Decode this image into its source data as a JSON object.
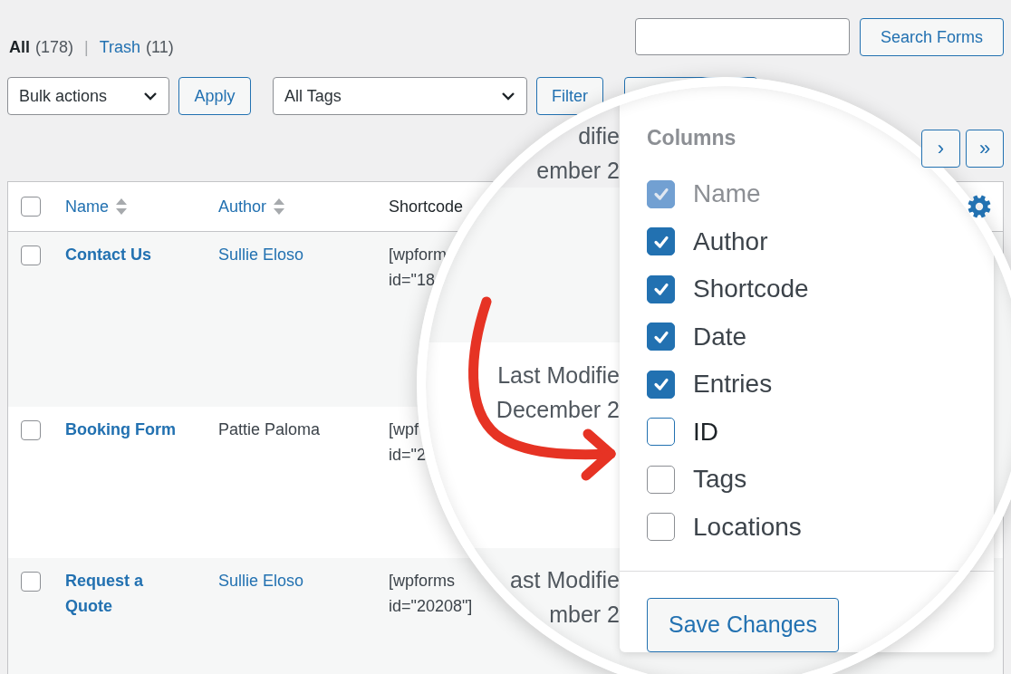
{
  "views": [
    {
      "label": "All",
      "count": "(178)",
      "selected": true
    },
    {
      "label": "Trash",
      "count": "(11)",
      "selected": false
    }
  ],
  "view_separator": "|",
  "search": {
    "button": "Search Forms"
  },
  "bulk_actions": {
    "value": "Bulk actions",
    "button": "Apply"
  },
  "tag_filter": {
    "value": "All Tags",
    "button": "Filter"
  },
  "pagination": [
    "›",
    "»"
  ],
  "table": {
    "header_checkbox": {
      "checked": false
    },
    "columns": [
      {
        "label": "Name",
        "sortable": true
      },
      {
        "label": "Author",
        "sortable": true
      },
      {
        "label": "Shortcode",
        "sortable": false
      }
    ],
    "rows": [
      {
        "checked": false,
        "name": "Contact Us",
        "author": "Sullie Eloso",
        "author_linked": true,
        "shortcode": [
          "[wpform",
          "id=\"18"
        ]
      },
      {
        "checked": false,
        "name": "Booking Form",
        "author": "Pattie Paloma",
        "author_linked": false,
        "shortcode": [
          "[wpf",
          "id=\"2"
        ]
      },
      {
        "checked": false,
        "name": "Request a Quote",
        "author": "Sullie Eloso",
        "author_linked": true,
        "shortcode": [
          "[wpforms",
          "id=\"20208\"]"
        ]
      }
    ]
  },
  "magnifier": {
    "magnified_lines": [
      [
        "difie",
        "ember 2"
      ],
      [
        "Last Modifie",
        "December 2"
      ],
      [
        "ast Modifie",
        "mber 2"
      ]
    ],
    "columns_menu": {
      "title": "Columns",
      "items": [
        {
          "label": "Name",
          "checked": true,
          "disabled": true,
          "focused": false
        },
        {
          "label": "Author",
          "checked": true,
          "disabled": false,
          "focused": false
        },
        {
          "label": "Shortcode",
          "checked": true,
          "disabled": false,
          "focused": false
        },
        {
          "label": "Date",
          "checked": true,
          "disabled": false,
          "focused": false
        },
        {
          "label": "Entries",
          "checked": true,
          "disabled": false,
          "focused": false
        },
        {
          "label": "ID",
          "checked": false,
          "disabled": false,
          "focused": true
        },
        {
          "label": "Tags",
          "checked": false,
          "disabled": false,
          "focused": false
        },
        {
          "label": "Locations",
          "checked": false,
          "disabled": false,
          "focused": false
        }
      ],
      "button": "Save Changes"
    }
  }
}
